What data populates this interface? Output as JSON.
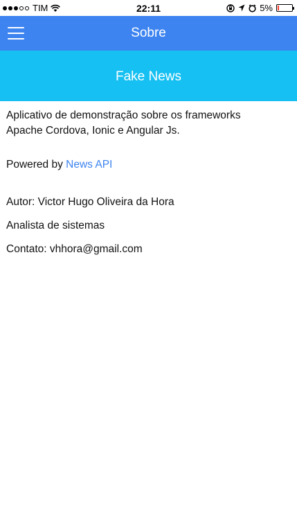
{
  "status_bar": {
    "carrier": "TIM",
    "time": "22:11",
    "battery": "5%",
    "battery_level": 0.05
  },
  "header": {
    "title": "Sobre"
  },
  "banner": {
    "title": "Fake News"
  },
  "content": {
    "description_line1": "Aplicativo de demonstração sobre os frameworks",
    "description_line2": "Apache Cordova, Ionic e Angular Js.",
    "powered_prefix": "Powered by",
    "powered_link": "News API",
    "author": "Autor: Victor Hugo Oliveira da Hora",
    "role": "Analista de sistemas",
    "contact": "Contato: vhhora@gmail.com"
  },
  "colors": {
    "header_bg": "#3d84f0",
    "banner_bg": "#16c0f2",
    "link": "#3d84f0"
  }
}
